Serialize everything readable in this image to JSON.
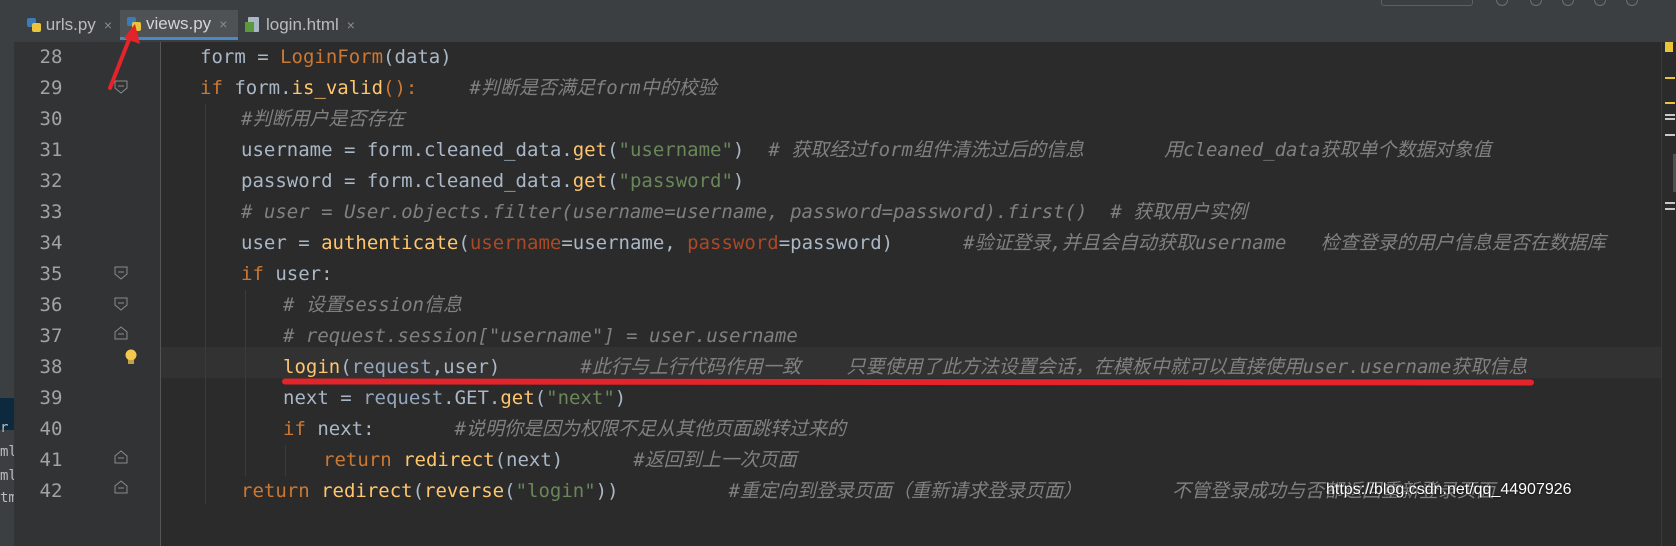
{
  "tabs": [
    {
      "label": "urls.py",
      "icon": "python-file-icon",
      "active": false
    },
    {
      "label": "views.py",
      "icon": "python-file-icon",
      "active": true
    },
    {
      "label": "login.html",
      "icon": "html-file-icon",
      "active": false
    }
  ],
  "close_glyph": "×",
  "left_strip_fragments": [
    "r",
    "ml",
    "ml",
    "tm"
  ],
  "line_numbers": [
    "28",
    "29",
    "30",
    "31",
    "32",
    "33",
    "34",
    "35",
    "36",
    "37",
    "38",
    "39",
    "40",
    "41",
    "42"
  ],
  "code": {
    "l28": {
      "a": "form = ",
      "b": "LoginForm",
      "c": "(data)"
    },
    "l29": {
      "a": "if ",
      "b": "form.",
      "c": "is_valid",
      "d": "():",
      "e": "#判断是否满足form中的校验"
    },
    "l30": {
      "a": "#判断用户是否存在"
    },
    "l31": {
      "a": "username = form.cleaned_data.",
      "b": "get",
      "c": "(",
      "d": "\"username\"",
      "e": ")",
      "f": "# 获取经过form组件清洗过后的信息       用cleaned_data获取单个数据对象值"
    },
    "l32": {
      "a": "password = form.cleaned_data.",
      "b": "get",
      "c": "(",
      "d": "\"password\"",
      "e": ")"
    },
    "l33": {
      "a": "# user = User.objects.filter(username=username, password=password).first()  # 获取用户实例"
    },
    "l34": {
      "a": "user = ",
      "b": "authenticate",
      "c": "(",
      "d": "username",
      "e": "=username, ",
      "f": "password",
      "g": "=password)",
      "h": "#验证登录,并且会自动获取username   检查登录的用户信息是否在数据库"
    },
    "l35": {
      "a": "if ",
      "b": "user:"
    },
    "l36": {
      "a": "# 设置session信息"
    },
    "l37": {
      "a": "# request.session[\"username\"] = user.username"
    },
    "l38": {
      "a": "login",
      "b": "(",
      "c": "request",
      "d": ",user)",
      "e": "#此行与上行代码作用一致    只要使用了此方法设置会话，在模板中就可以直接使用user.username获取信息"
    },
    "l39": {
      "a": "next = ",
      "b": "request",
      "c": ".GET.",
      "d": "get",
      "e": "(",
      "f": "\"next\"",
      "g": ")"
    },
    "l40": {
      "a": "if ",
      "b": "next:",
      "c": "#说明你是因为权限不足从其他页面跳转过来的"
    },
    "l41": {
      "a": "return ",
      "b": "redirect",
      "c": "(next)",
      "d": "#返回到上一次页面"
    },
    "l42": {
      "a": "return ",
      "b": "redirect",
      "c": "(",
      "d": "reverse",
      "e": "(",
      "f": "\"login\"",
      "g": "))",
      "h": "#重定向到登录页面（重新请求登录页面）",
      "i": "不管登录成功与否都返回重新登录页面"
    }
  },
  "watermark": "https://blog.csdn.net/qq_44907926",
  "colors": {
    "background": "#2b2b2b",
    "gutter": "#313335",
    "keyword": "#cc7832",
    "function": "#ffc66d",
    "string": "#6a8759",
    "comment": "#808080",
    "parameter": "#aa4926",
    "default_text": "#a9b7c6",
    "annotation_red": "#e3242b",
    "active_tab_underline": "#4a88c7"
  }
}
